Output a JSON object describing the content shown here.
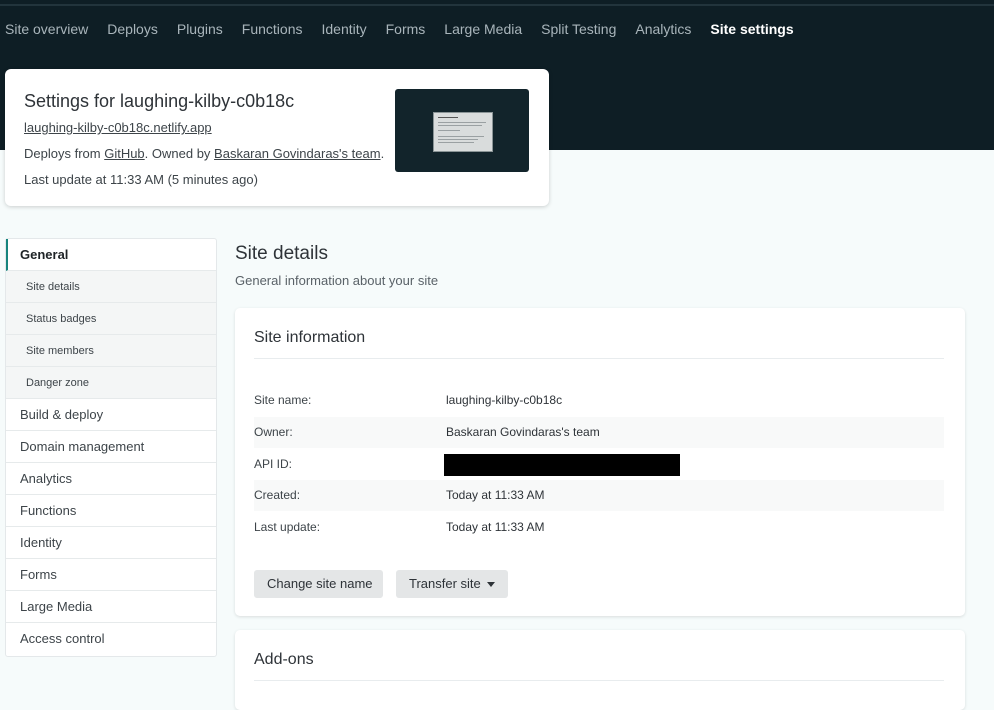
{
  "nav": {
    "items": [
      "Site overview",
      "Deploys",
      "Plugins",
      "Functions",
      "Identity",
      "Forms",
      "Large Media",
      "Split Testing",
      "Analytics",
      "Site settings"
    ],
    "active": "Site settings"
  },
  "site": {
    "title": "Settings for laughing-kilby-c0b18c",
    "url": "laughing-kilby-c0b18c.netlify.app",
    "deploys_prefix": "Deploys from ",
    "deploys_source": "GitHub",
    "owned_prefix": ". Owned by ",
    "owner": "Baskaran Govindaras's team",
    "owned_suffix": ".",
    "last_update": "Last update at 11:33 AM (5 minutes ago)"
  },
  "sidebar": {
    "items": [
      {
        "label": "General",
        "type": "section",
        "active": true
      },
      {
        "label": "Site details",
        "type": "sub"
      },
      {
        "label": "Status badges",
        "type": "sub"
      },
      {
        "label": "Site members",
        "type": "sub"
      },
      {
        "label": "Danger zone",
        "type": "sub"
      },
      {
        "label": "Build & deploy",
        "type": "section"
      },
      {
        "label": "Domain management",
        "type": "section"
      },
      {
        "label": "Analytics",
        "type": "section"
      },
      {
        "label": "Functions",
        "type": "section"
      },
      {
        "label": "Identity",
        "type": "section"
      },
      {
        "label": "Forms",
        "type": "section"
      },
      {
        "label": "Large Media",
        "type": "section"
      },
      {
        "label": "Access control",
        "type": "section"
      }
    ]
  },
  "main": {
    "title": "Site details",
    "subtitle": "General information about your site"
  },
  "site_info": {
    "title": "Site information",
    "rows": [
      {
        "label": "Site name:",
        "value": "laughing-kilby-c0b18c"
      },
      {
        "label": "Owner:",
        "value": "Baskaran Govindaras's team"
      },
      {
        "label": "API ID:",
        "value": ""
      },
      {
        "label": "Created:",
        "value": "Today at 11:33 AM"
      },
      {
        "label": "Last update:",
        "value": "Today at 11:33 AM"
      }
    ],
    "change_button": "Change site name",
    "transfer_button": "Transfer site"
  },
  "addons": {
    "title": "Add-ons"
  },
  "colors": {
    "header_bg": "#0e1e25",
    "accent": "#15847d",
    "page_bg": "#f6fbfb"
  }
}
